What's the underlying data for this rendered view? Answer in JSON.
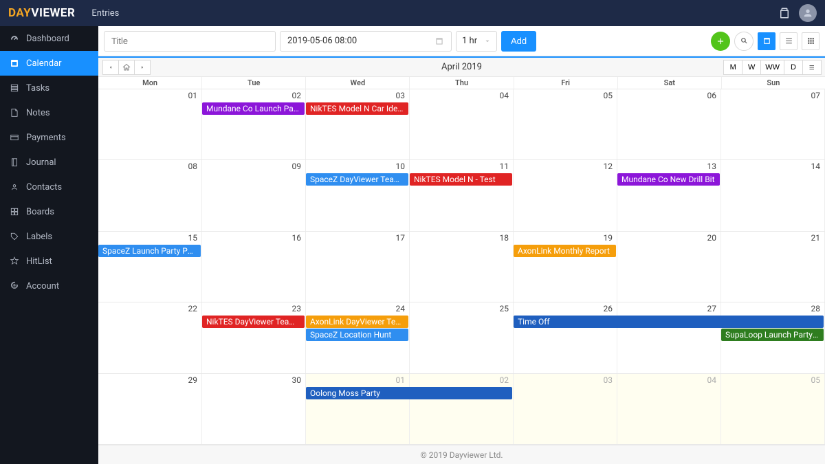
{
  "app": {
    "logo_prefix": "DAY",
    "logo_suffix": "VIEWER",
    "entries_label": "Entries"
  },
  "sidebar": {
    "items": [
      {
        "label": "Dashboard"
      },
      {
        "label": "Calendar"
      },
      {
        "label": "Tasks"
      },
      {
        "label": "Notes"
      },
      {
        "label": "Payments"
      },
      {
        "label": "Journal"
      },
      {
        "label": "Contacts"
      },
      {
        "label": "Boards"
      },
      {
        "label": "Labels"
      },
      {
        "label": "HitList"
      },
      {
        "label": "Account"
      }
    ]
  },
  "toolbar": {
    "title_placeholder": "Title",
    "date_value": "2019-05-06 08:00",
    "duration_value": "1 hr",
    "add_label": "Add"
  },
  "calendar": {
    "title": "April 2019",
    "view_buttons": {
      "month": "M",
      "week": "W",
      "work_week": "WW",
      "day": "D"
    },
    "dow": [
      "Mon",
      "Tue",
      "Wed",
      "Thu",
      "Fri",
      "Sat",
      "Sun"
    ],
    "weeks": [
      {
        "days": [
          {
            "n": "01"
          },
          {
            "n": "02"
          },
          {
            "n": "03"
          },
          {
            "n": "04"
          },
          {
            "n": "05"
          },
          {
            "n": "06"
          },
          {
            "n": "07"
          }
        ],
        "events": [
          {
            "label": "Mundane Co Launch Party …",
            "color": "#8c16d9",
            "start": 1,
            "span": 1,
            "row": 0
          },
          {
            "label": "NikTES Model N Car Ideas",
            "color": "#e02424",
            "start": 2,
            "span": 1,
            "row": 0
          }
        ]
      },
      {
        "days": [
          {
            "n": "08"
          },
          {
            "n": "09"
          },
          {
            "n": "10"
          },
          {
            "n": "11"
          },
          {
            "n": "12"
          },
          {
            "n": "13"
          },
          {
            "n": "14"
          }
        ],
        "events": [
          {
            "label": "SpaceZ DayViewer Team Ro…",
            "color": "#2f8ef0",
            "start": 2,
            "span": 1,
            "row": 0
          },
          {
            "label": "NikTES Model N - Test",
            "color": "#e02424",
            "start": 3,
            "span": 1,
            "row": 0
          },
          {
            "label": "Mundane Co New Drill Bit",
            "color": "#8c16d9",
            "start": 5,
            "span": 1,
            "row": 0
          }
        ]
      },
      {
        "days": [
          {
            "n": "15"
          },
          {
            "n": "16"
          },
          {
            "n": "17"
          },
          {
            "n": "18"
          },
          {
            "n": "19"
          },
          {
            "n": "20"
          },
          {
            "n": "21"
          }
        ],
        "events": [
          {
            "label": "SpaceZ Launch Party Paym…",
            "color": "#2f8ef0",
            "start": 0,
            "span": 1,
            "row": 0
          },
          {
            "label": "AxonLink Monthly Report",
            "color": "#f59e0b",
            "start": 4,
            "span": 1,
            "row": 0
          }
        ]
      },
      {
        "days": [
          {
            "n": "22"
          },
          {
            "n": "23"
          },
          {
            "n": "24"
          },
          {
            "n": "25"
          },
          {
            "n": "26"
          },
          {
            "n": "27"
          },
          {
            "n": "28"
          }
        ],
        "events": [
          {
            "label": "NikTES DayViewer Team Room",
            "color": "#e02424",
            "start": 1,
            "span": 1,
            "row": 0
          },
          {
            "label": "AxonLink DayViewer Team …",
            "color": "#f59e0b",
            "start": 2,
            "span": 1,
            "row": 0
          },
          {
            "label": "SpaceZ Location Hunt",
            "color": "#2f8ef0",
            "start": 2,
            "span": 1,
            "row": 1
          },
          {
            "label": "Time Off",
            "color": "#1f5fbf",
            "start": 4,
            "span": 3,
            "row": 0
          },
          {
            "label": "SupaLoop Launch Party Pa…",
            "color": "#2e7d1f",
            "start": 6,
            "span": 1,
            "row": 1
          }
        ]
      },
      {
        "days": [
          {
            "n": "29"
          },
          {
            "n": "30"
          },
          {
            "n": "01",
            "out": true
          },
          {
            "n": "02",
            "out": true
          },
          {
            "n": "03",
            "out": true
          },
          {
            "n": "04",
            "out": true
          },
          {
            "n": "05",
            "out": true
          }
        ],
        "events": [
          {
            "label": "Oolong Moss Party",
            "color": "#1f5fbf",
            "start": 2,
            "span": 2,
            "row": 0
          }
        ]
      }
    ]
  },
  "footer": {
    "text": "© 2019 Dayviewer Ltd."
  }
}
